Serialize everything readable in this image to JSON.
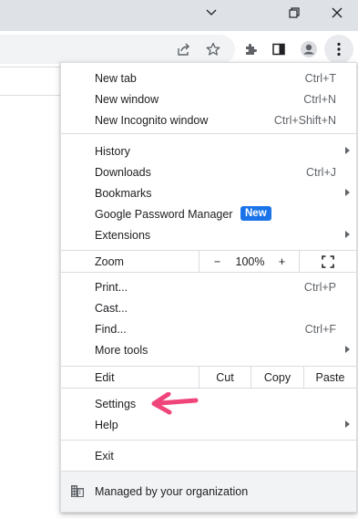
{
  "colors": {
    "accent": "#1a73e8",
    "annotation_arrow": "#f0457a"
  },
  "window": {
    "controls": [
      {
        "name": "chevron-down-icon"
      },
      {
        "name": "restore-icon"
      },
      {
        "name": "close-icon"
      }
    ]
  },
  "toolbar": {
    "icons": [
      "share-icon",
      "star-icon",
      "extensions-icon",
      "side-panel-icon",
      "profile-icon",
      "more-vert-icon"
    ]
  },
  "menu": {
    "new_tab": {
      "label": "New tab",
      "accel": "Ctrl+T"
    },
    "new_window": {
      "label": "New window",
      "accel": "Ctrl+N"
    },
    "new_incognito": {
      "label": "New Incognito window",
      "accel": "Ctrl+Shift+N"
    },
    "history": {
      "label": "History"
    },
    "downloads": {
      "label": "Downloads",
      "accel": "Ctrl+J"
    },
    "bookmarks": {
      "label": "Bookmarks"
    },
    "password_manager": {
      "label": "Google Password Manager",
      "badge": "New"
    },
    "extensions": {
      "label": "Extensions"
    },
    "zoom": {
      "label": "Zoom",
      "minus": "−",
      "value": "100%",
      "plus": "+"
    },
    "print": {
      "label": "Print...",
      "accel": "Ctrl+P"
    },
    "cast": {
      "label": "Cast..."
    },
    "find": {
      "label": "Find...",
      "accel": "Ctrl+F"
    },
    "more_tools": {
      "label": "More tools"
    },
    "edit": {
      "label": "Edit",
      "cut": "Cut",
      "copy": "Copy",
      "paste": "Paste"
    },
    "settings": {
      "label": "Settings"
    },
    "help": {
      "label": "Help"
    },
    "exit": {
      "label": "Exit"
    },
    "managed": {
      "label": "Managed by your organization"
    }
  }
}
